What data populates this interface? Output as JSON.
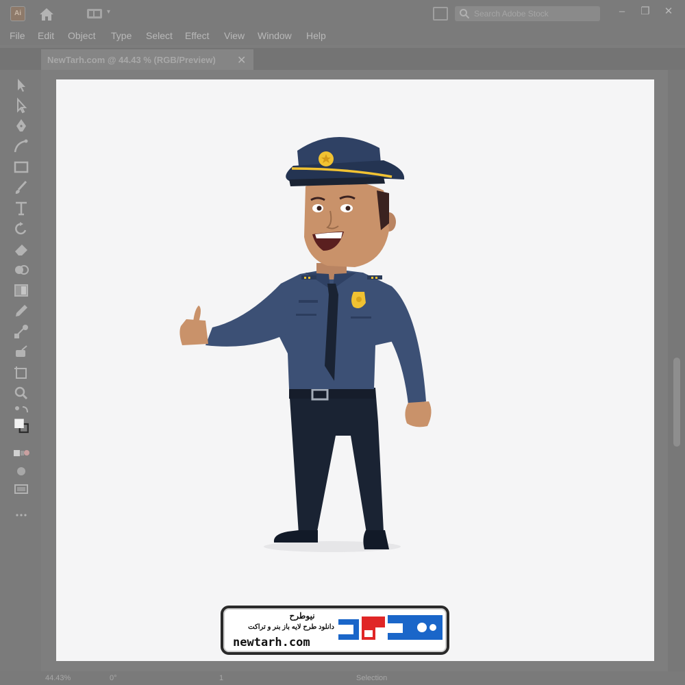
{
  "app": {
    "logo_text": "Ai",
    "menu": [
      "File",
      "Edit",
      "Object",
      "Type",
      "Select",
      "Effect",
      "View",
      "Window",
      "Help"
    ],
    "search_placeholder": "Search Adobe Stock",
    "window_controls": [
      "–",
      "❐",
      "✕"
    ]
  },
  "document": {
    "tab_title": "NewTarh.com @ 44.43 % (RGB/Preview)",
    "tab_close": "✕"
  },
  "status": {
    "zoom": "44.43%",
    "rotation": "0°",
    "page": "1",
    "tool": "Selection"
  },
  "watermark": {
    "brand_fa": "نیوطرح",
    "tagline_fa": "دانلود طرح لایه باز بنر و تراکت",
    "domain": "newtarh.com",
    "logo_fa": "نیوطرح",
    "colors": {
      "accent_blue": "#1a66c9",
      "accent_red": "#e02626"
    }
  },
  "tools": [
    "selection-tool",
    "direct-selection-tool",
    "pen-tool",
    "curvature-tool",
    "rectangle-tool",
    "paintbrush-tool",
    "type-tool",
    "rotate-tool",
    "eraser-tool",
    "shape-builder-tool",
    "gradient-tool",
    "eyedropper-tool",
    "blend-tool",
    "symbol-sprayer-tool",
    "artboard-tool",
    "zoom-tool"
  ]
}
